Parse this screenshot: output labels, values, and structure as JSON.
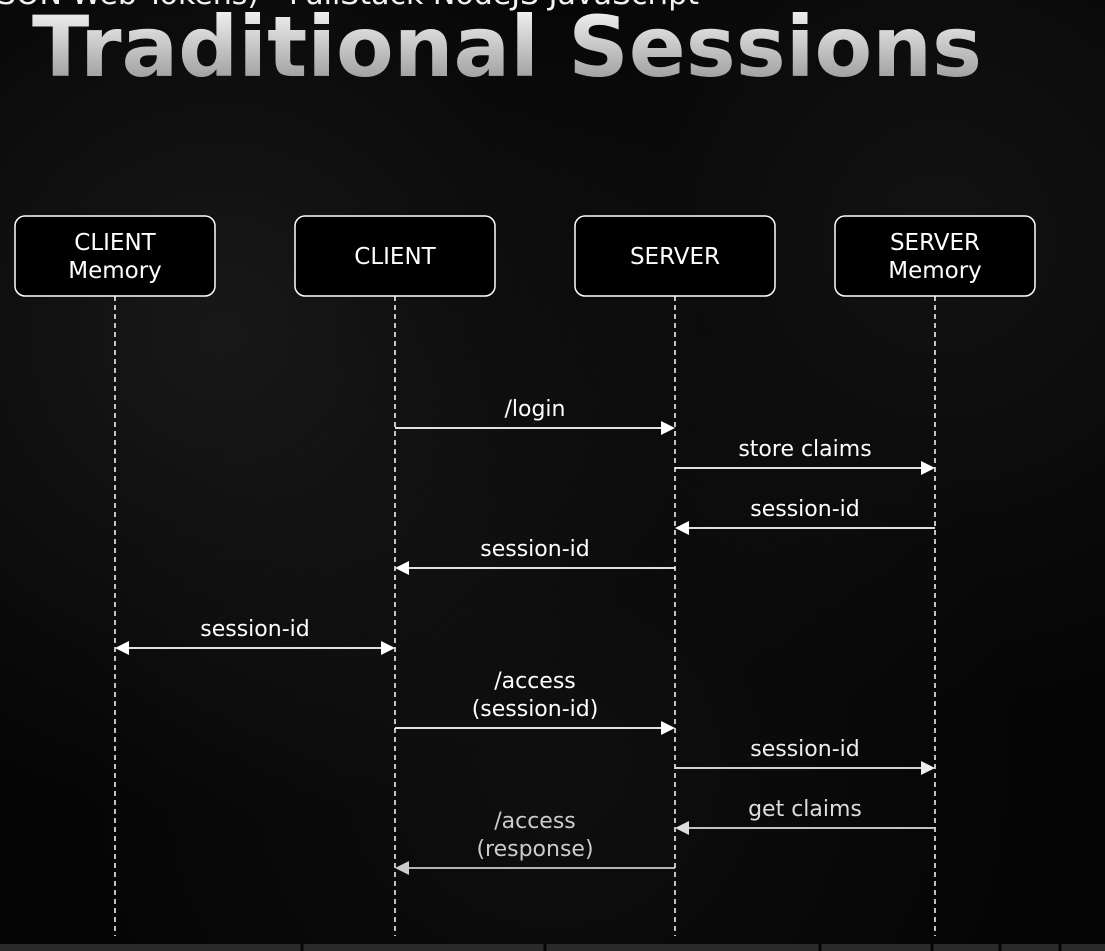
{
  "slide": {
    "subtitle": "JSON Web Tokens) - FullStack NodeJS JavaScript",
    "title": "Traditional Sessions"
  },
  "diagram": {
    "actors": [
      {
        "id": "client-memory",
        "lines": [
          "CLIENT",
          "Memory"
        ]
      },
      {
        "id": "client",
        "lines": [
          "CLIENT"
        ]
      },
      {
        "id": "server",
        "lines": [
          "SERVER"
        ]
      },
      {
        "id": "server-memory",
        "lines": [
          "SERVER",
          "Memory"
        ]
      }
    ],
    "messages": [
      {
        "from": "client",
        "to": "server",
        "lines": [
          "/login"
        ],
        "color": "#ffffff"
      },
      {
        "from": "server",
        "to": "server-memory",
        "lines": [
          "store claims"
        ],
        "color": "#ffffff"
      },
      {
        "from": "server-memory",
        "to": "server",
        "lines": [
          "session-id"
        ],
        "color": "#ffffff"
      },
      {
        "from": "server",
        "to": "client",
        "lines": [
          "session-id"
        ],
        "color": "#ffffff"
      },
      {
        "from": "client-memory",
        "to": "client",
        "lines": [
          "session-id"
        ],
        "bidirectional": true,
        "color": "#ffffff"
      },
      {
        "from": "client",
        "to": "server",
        "lines": [
          "/access",
          "(session-id)"
        ],
        "color": "#ffffff"
      },
      {
        "from": "server",
        "to": "server-memory",
        "lines": [
          "session-id"
        ],
        "color": "#eeeeee"
      },
      {
        "from": "server-memory",
        "to": "server",
        "lines": [
          "get claims"
        ],
        "color": "#dddddd"
      },
      {
        "from": "server",
        "to": "client",
        "lines": [
          "/access",
          "(response)"
        ],
        "color": "#cccccc"
      }
    ]
  },
  "colors": {
    "background": "#050505",
    "foreground": "#ffffff"
  }
}
